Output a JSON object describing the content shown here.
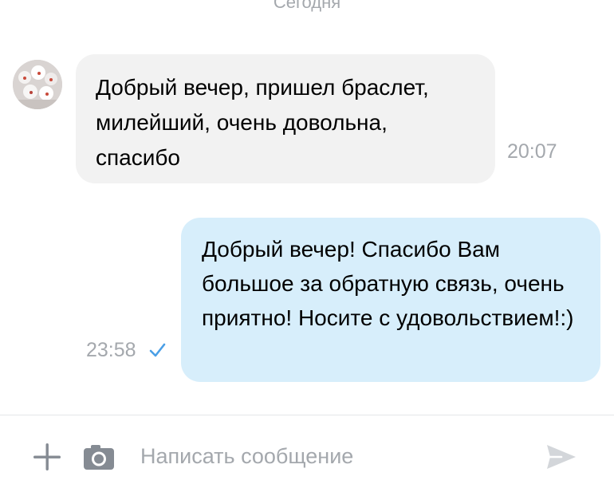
{
  "chat": {
    "date_separator": "Сегодня",
    "messages": [
      {
        "direction": "incoming",
        "text": "Добрый вечер, пришел браслет, милейший, очень довольна, спасибо",
        "time": "20:07"
      },
      {
        "direction": "outgoing",
        "text": "Добрый вечер! Спасибо Вам большое за обратную связь, очень приятно! Носите с удовольствием!:)",
        "time": "23:58",
        "status_icon": "check-icon"
      }
    ]
  },
  "composer": {
    "placeholder": "Написать сообщение",
    "value": "",
    "attach_icon": "plus-icon",
    "camera_icon": "camera-icon",
    "send_icon": "send-icon"
  },
  "colors": {
    "incoming_bubble": "#f2f2f2",
    "outgoing_bubble": "#d7eefb",
    "timestamp": "#a4a8ad",
    "read_check": "#4a9fe6",
    "icon_gray": "#858b93",
    "send_disabled": "#d3d6da"
  }
}
